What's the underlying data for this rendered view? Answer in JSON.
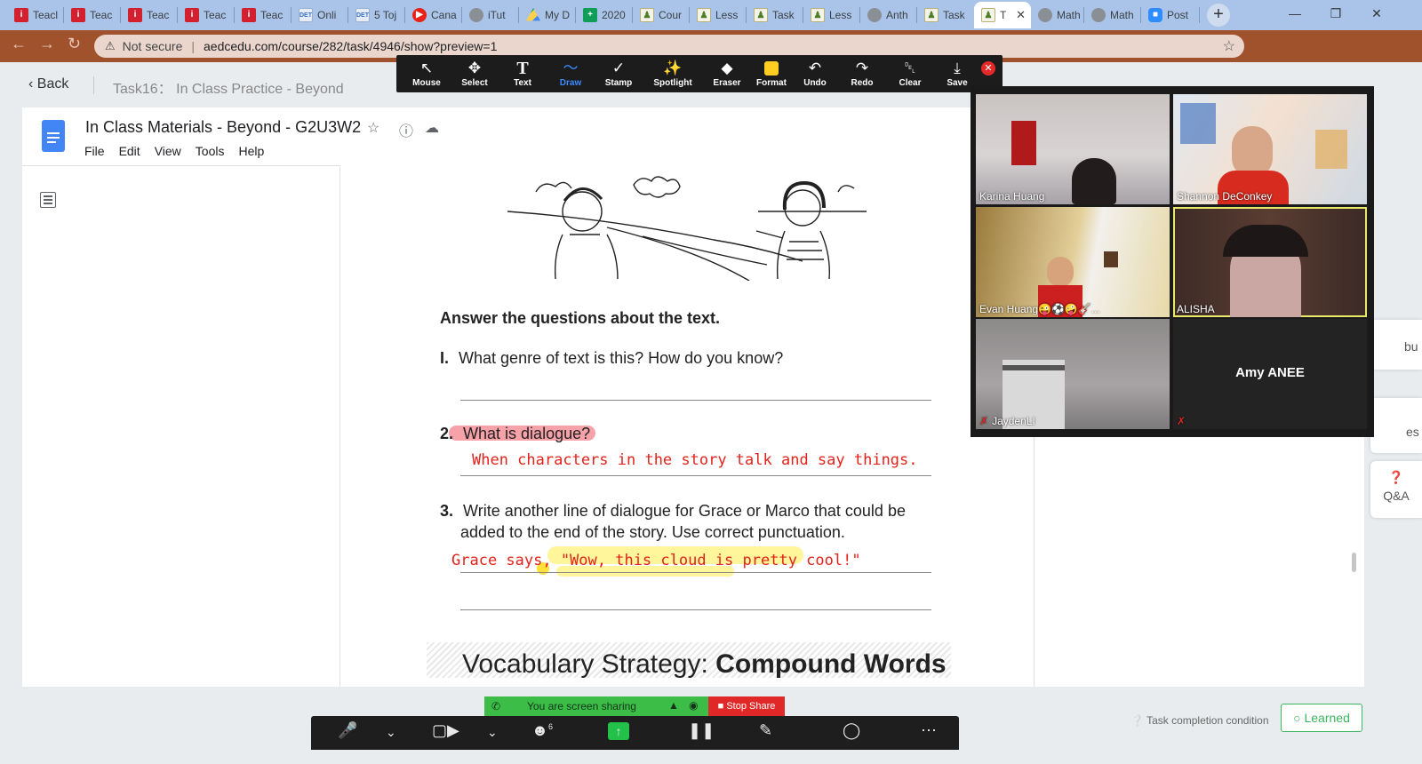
{
  "browser": {
    "tabs": [
      {
        "title": "Teacl",
        "icon": "i-brand-icon"
      },
      {
        "title": "Teac",
        "icon": "i-brand-icon"
      },
      {
        "title": "Teac",
        "icon": "i-brand-icon"
      },
      {
        "title": "Teac",
        "icon": "i-brand-icon"
      },
      {
        "title": "Teac",
        "icon": "i-brand-icon"
      },
      {
        "title": "Onli",
        "icon": "doc-icon"
      },
      {
        "title": "5 Toj",
        "icon": "doc-icon"
      },
      {
        "title": "Cana",
        "icon": "record-icon"
      },
      {
        "title": "iTut",
        "icon": "globe-icon"
      },
      {
        "title": "My D",
        "icon": "drive-icon"
      },
      {
        "title": "2020",
        "icon": "sheets-icon"
      },
      {
        "title": "Cour",
        "icon": "task-icon"
      },
      {
        "title": "Less",
        "icon": "task-icon"
      },
      {
        "title": "Task",
        "icon": "task-icon"
      },
      {
        "title": "Less",
        "icon": "task-icon"
      },
      {
        "title": "Anth",
        "icon": "globe-icon"
      },
      {
        "title": "Task",
        "icon": "task-icon"
      },
      {
        "title": "T",
        "icon": "task-icon",
        "active": true
      },
      {
        "title": "Math",
        "icon": "globe-icon"
      },
      {
        "title": "Math",
        "icon": "globe-icon"
      },
      {
        "title": "Post",
        "icon": "zoom-icon"
      }
    ],
    "new_tab_label": "+",
    "security_label": "Not secure",
    "url": "aedcedu.com/course/282/task/4946/show?preview=1"
  },
  "page": {
    "back_label": "Back",
    "task_title": "Task16： In Class Practice - Beyond",
    "task_condition": "Task completion condition",
    "learned_label": "Learned",
    "qa_label": "Q&A",
    "side_label_1": "bu",
    "side_label_2": "es"
  },
  "doc": {
    "title": "In Class Materials - Beyond - G2U3W2",
    "menu": [
      "File",
      "Edit",
      "View",
      "Tools",
      "Help"
    ],
    "heading": "Answer the questions about the text.",
    "questions": [
      {
        "num": "I.",
        "text": "What genre of text is this? How do you know?"
      },
      {
        "num": "2.",
        "text": "What is dialogue?"
      },
      {
        "num": "3.",
        "text": "Write another line of dialogue for Grace or Marco that could be",
        "text2": "added to the end of the story. Use correct punctuation."
      }
    ],
    "answer_2": "When characters in the story talk and say things.",
    "answer_3": "Grace says, \"Wow, this cloud is pretty cool!\"",
    "vocab_prefix": "Vocabulary Strategy: ",
    "vocab_bold": "Compound Words"
  },
  "annotate_toolbar": {
    "tools": [
      {
        "label": "Mouse",
        "icon": "cursor-icon",
        "glyph": "↖"
      },
      {
        "label": "Select",
        "icon": "move-icon",
        "glyph": "✥"
      },
      {
        "label": "Text",
        "icon": "text-icon",
        "glyph": "T"
      },
      {
        "label": "Draw",
        "icon": "squiggle-icon",
        "glyph": "〜",
        "selected": true
      },
      {
        "label": "Stamp",
        "icon": "check-icon",
        "glyph": "✓"
      },
      {
        "label": "Spotlight",
        "icon": "wand-icon",
        "glyph": "✨"
      },
      {
        "label": "Eraser",
        "icon": "eraser-icon",
        "glyph": "◆"
      },
      {
        "label": "Format",
        "icon": "color-swatch-icon",
        "glyph": ""
      },
      {
        "label": "Undo",
        "icon": "undo-icon",
        "glyph": "↶"
      },
      {
        "label": "Redo",
        "icon": "redo-icon",
        "glyph": "↷"
      },
      {
        "label": "Clear",
        "icon": "trash-icon",
        "glyph": "␡"
      },
      {
        "label": "Save",
        "icon": "save-icon",
        "glyph": "⤓"
      }
    ],
    "format_color": "#ffcd21",
    "selected_color": "#3a8bff"
  },
  "gallery": {
    "participants": [
      {
        "name": "Karina Huang",
        "muted": false
      },
      {
        "name": "Shannon DeConkey",
        "muted": false
      },
      {
        "name": "Evan Huang😜⚽🤪🎸...",
        "muted": false
      },
      {
        "name": "ALISHA",
        "muted": false,
        "speaking": true
      },
      {
        "name": "JaydenLI",
        "muted": true
      },
      {
        "name": "Amy ANEE",
        "muted": true,
        "video_off": true
      }
    ]
  },
  "zoom": {
    "share_banner": "You are screen sharing",
    "stop_share": "Stop Share",
    "participant_count": "6"
  },
  "colors": {
    "annotation_red": "#e3231b",
    "highlight_yellow": "#fff27a",
    "highlight_pink": "#f7a1a8",
    "learned_green": "#3cb55f",
    "share_green": "#3bbd48",
    "stop_red": "#e02828"
  }
}
